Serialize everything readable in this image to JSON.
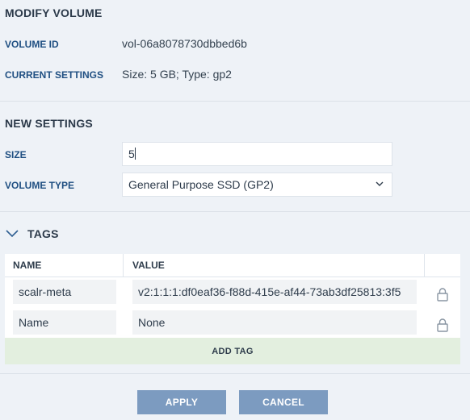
{
  "modify_volume": {
    "title": "MODIFY VOLUME",
    "volume_id_label": "VOLUME ID",
    "volume_id_value": "vol-06a8078730dbbed6b",
    "current_settings_label": "CURRENT SETTINGS",
    "current_settings_value": "Size: 5 GB; Type: gp2"
  },
  "new_settings": {
    "title": "NEW SETTINGS",
    "size_label": "SIZE",
    "size_value": "5",
    "volume_type_label": "VOLUME TYPE",
    "volume_type_value": "General Purpose SSD (GP2)"
  },
  "tags": {
    "title": "TAGS",
    "columns": [
      "NAME",
      "VALUE"
    ],
    "rows": [
      {
        "name": "scalr-meta",
        "value": "v2:1:1:1:df0eaf36-f88d-415e-af44-73ab3df25813:3f5",
        "locked": true
      },
      {
        "name": "Name",
        "value": "None",
        "locked": true
      }
    ],
    "add_label": "ADD TAG"
  },
  "actions": {
    "apply_label": "APPLY",
    "cancel_label": "CANCEL"
  },
  "colors": {
    "background": "#eef2f7",
    "label_blue": "#1f4f82",
    "button": "#7c9bc0",
    "add_tag_bg": "#e3efdf"
  },
  "icons": {
    "tags_toggle": "chevron-down-icon",
    "volume_type_select": "chevron-down-icon",
    "row_lock": "lock-icon"
  }
}
